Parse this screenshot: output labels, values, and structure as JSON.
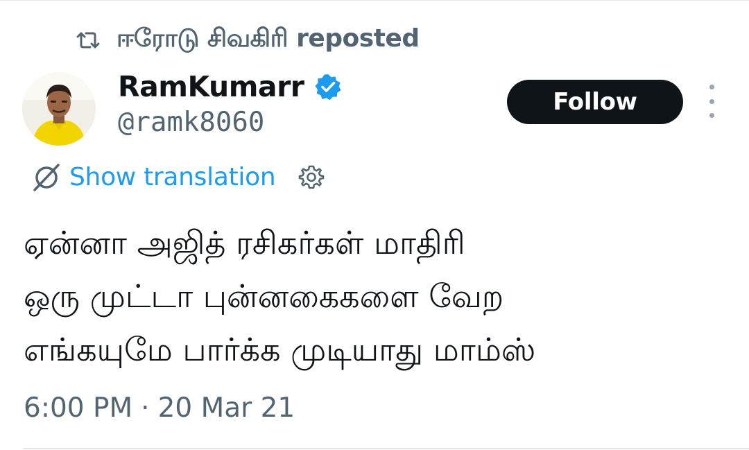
{
  "repost": {
    "icon": "repost-icon",
    "text": "ஈரோடு சிவகிரி reposted"
  },
  "author": {
    "avatar_icon": "avatar",
    "display_name": "RamKumarr",
    "verified_icon": "verified-badge-icon",
    "handle": "@ramk8060"
  },
  "actions": {
    "follow_label": "Follow",
    "more_icon": "more-vertical-icon"
  },
  "translation": {
    "icon": "translate-icon",
    "label": "Show translation",
    "settings_icon": "gear-icon"
  },
  "tweet": {
    "lines": [
      "ஏன்னா அஜித் ரசிகர்கள் மாதிரி",
      "ஒரு முட்டா புன்னகைகளை வேற",
      "எங்கயுமே பார்க்க முடியாது மாம்ஸ்"
    ]
  },
  "meta": {
    "time": "6:00 PM",
    "separator": "·",
    "date": "20 Mar 21"
  },
  "colors": {
    "text_primary": "#0f1419",
    "text_secondary": "#536471",
    "link": "#1d9bf0",
    "follow_bg": "#0f1419",
    "verified": "#1d9bf0"
  }
}
